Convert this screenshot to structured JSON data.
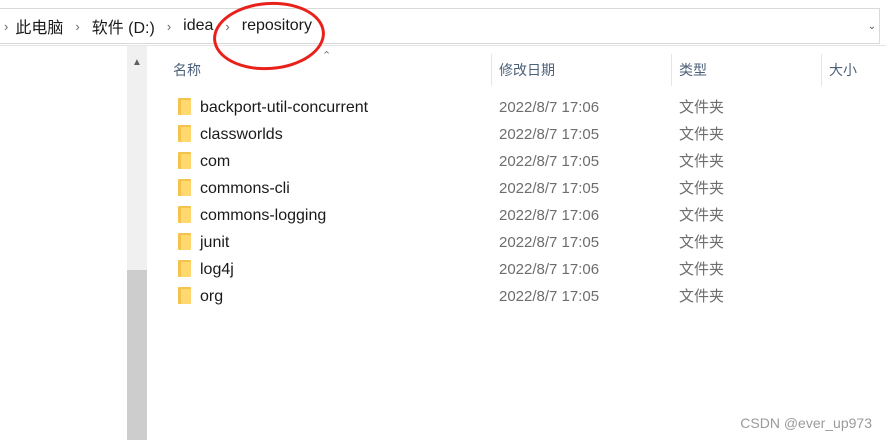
{
  "breadcrumbs": [
    "此电脑",
    "软件 (D:)",
    "idea",
    "repository"
  ],
  "columns": {
    "name": "名称",
    "date": "修改日期",
    "type": "类型",
    "size": "大小"
  },
  "files": [
    {
      "name": "backport-util-concurrent",
      "date": "2022/8/7 17:06",
      "type": "文件夹"
    },
    {
      "name": "classworlds",
      "date": "2022/8/7 17:05",
      "type": "文件夹"
    },
    {
      "name": "com",
      "date": "2022/8/7 17:05",
      "type": "文件夹"
    },
    {
      "name": "commons-cli",
      "date": "2022/8/7 17:05",
      "type": "文件夹"
    },
    {
      "name": "commons-logging",
      "date": "2022/8/7 17:06",
      "type": "文件夹"
    },
    {
      "name": "junit",
      "date": "2022/8/7 17:05",
      "type": "文件夹"
    },
    {
      "name": "log4j",
      "date": "2022/8/7 17:06",
      "type": "文件夹"
    },
    {
      "name": "org",
      "date": "2022/8/7 17:05",
      "type": "文件夹"
    }
  ],
  "watermark": "CSDN @ever_up973",
  "colors": {
    "annotation": "#e8221b",
    "folder": "#ffd970",
    "header_text": "#4c607a"
  }
}
